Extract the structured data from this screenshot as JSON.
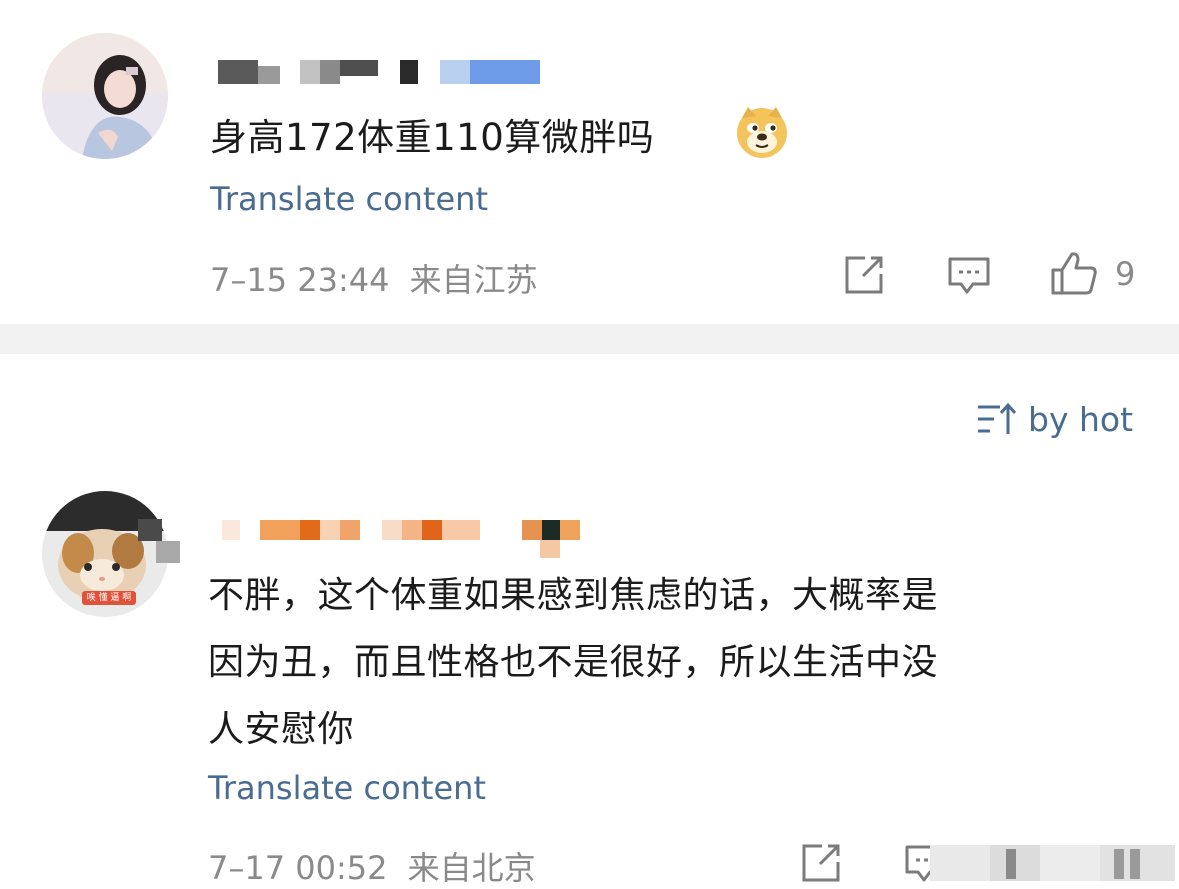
{
  "comments": [
    {
      "text": "身高172体重110算微胖吗",
      "emoji": "doge-emoji",
      "translate_label": "Translate content",
      "time": "7–15 23:44",
      "location": "来自江苏",
      "like_count": "9"
    },
    {
      "lines": [
        "不胖，这个体重如果感到焦虑的话，大概率是",
        "因为丑，而且性格也不是很好，所以生活中没",
        "人安慰你"
      ],
      "avatar_badge": "唉 懂 逼 啊",
      "translate_label": "Translate content",
      "time": "7–17 00:52",
      "location": "来自北京"
    }
  ],
  "sort": {
    "label": "by hot",
    "icon": "sort-icon"
  },
  "colors": {
    "link": "#4a6c91",
    "meta": "#8a8a8a",
    "divider": "#f2f2f2"
  }
}
